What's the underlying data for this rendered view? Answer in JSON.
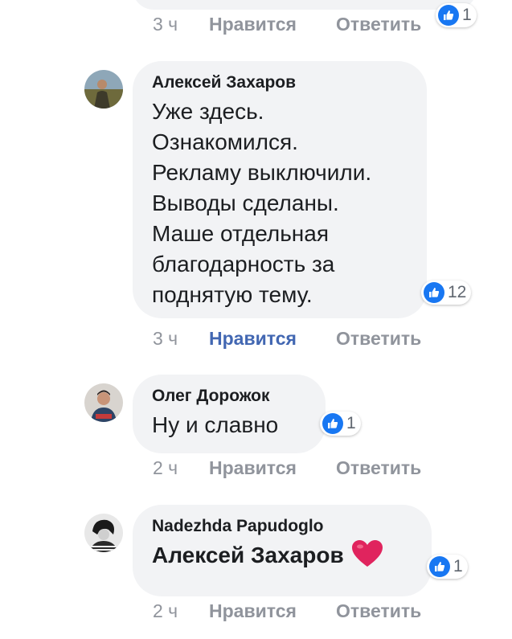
{
  "top": {
    "time": "3 ч",
    "like": "Нравится",
    "reply": "Ответить",
    "reactions": "1"
  },
  "comments": [
    {
      "author": "Алексей Захаров",
      "text": "Уже здесь.\nОзнакомился.\nРекламу выключили.\nВыводы сделаны.\nМаше отдельная\nблагодарность за\nподнятую тему.",
      "reactions": "12",
      "time": "3 ч",
      "like": "Нравится",
      "reply": "Ответить"
    },
    {
      "author": "Олег Дорожок",
      "text": "Ну и славно",
      "reactions": "1",
      "time": "2 ч",
      "like": "Нравится",
      "reply": "Ответить"
    },
    {
      "author": "Nadezhda Papudoglo",
      "text": "Алексей Захаров",
      "reactions": "1",
      "time": "2 ч",
      "like": "Нравится",
      "reply": "Ответить"
    }
  ],
  "colors": {
    "like_blue": "#1877f2",
    "active_like": "#4267b2",
    "muted": "#90949c",
    "bubble": "#f2f3f5",
    "heart": "#e0245e"
  },
  "icons": {
    "like": "thumbs-up-icon",
    "heart": "heart-icon"
  }
}
